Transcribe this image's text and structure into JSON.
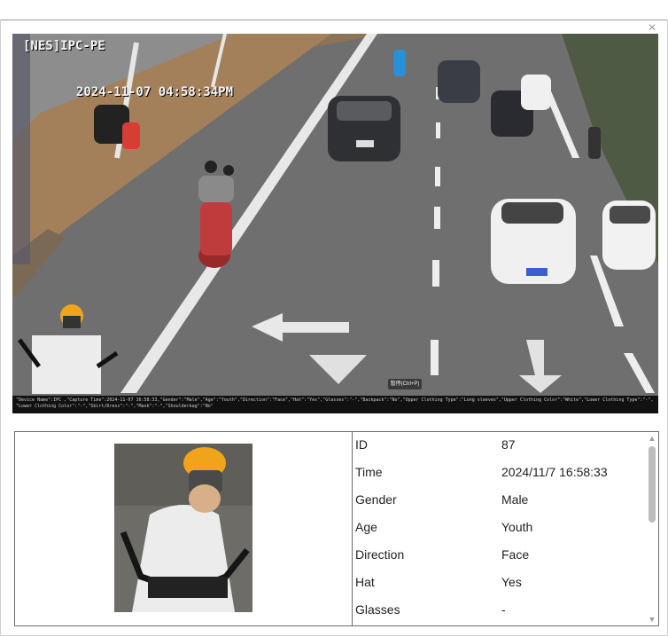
{
  "window": {
    "close_glyph": "×"
  },
  "camera": {
    "device_label": "[NES]IPC-PE",
    "timestamp": "2024-11-07 04:58:34PM",
    "pause_label": "暂停(Ctrl+P)",
    "meta_line1": "\"Device Name\":IPC ,\"Capture Time\":2024-11-07 16:58:33,\"Gender\":\"Male\",\"Age\":\"Youth\",\"Direction\":\"Face\",\"Hat\":\"Yes\",\"Glasses\":\"-\",\"Backpack\":\"No\",\"Upper Clothing Type\":\"Long sleeves\",\"Upper Clothing Color\":\"White\",\"Lower Clothing Type\":\"-\",",
    "meta_line2": "\"Lower Clothing Color\":\"-\",\"Skirt/Dress\":\"-\",\"Mask\":\"-\",\"Shoulderbag\":\"No\""
  },
  "details": {
    "rows": [
      {
        "key": "ID",
        "value": "87"
      },
      {
        "key": "Time",
        "value": "2024/11/7 16:58:33"
      },
      {
        "key": "Gender",
        "value": "Male"
      },
      {
        "key": "Age",
        "value": "Youth"
      },
      {
        "key": "Direction",
        "value": "Face"
      },
      {
        "key": "Hat",
        "value": "Yes"
      },
      {
        "key": "Glasses",
        "value": "-"
      }
    ]
  },
  "scrollbar": {
    "up_glyph": "▲",
    "down_glyph": "▼"
  },
  "colors": {
    "helmet": "#f0a41c",
    "road": "#6e6e6e",
    "sidewalk": "#a4805a",
    "shirt": "#ececec"
  }
}
